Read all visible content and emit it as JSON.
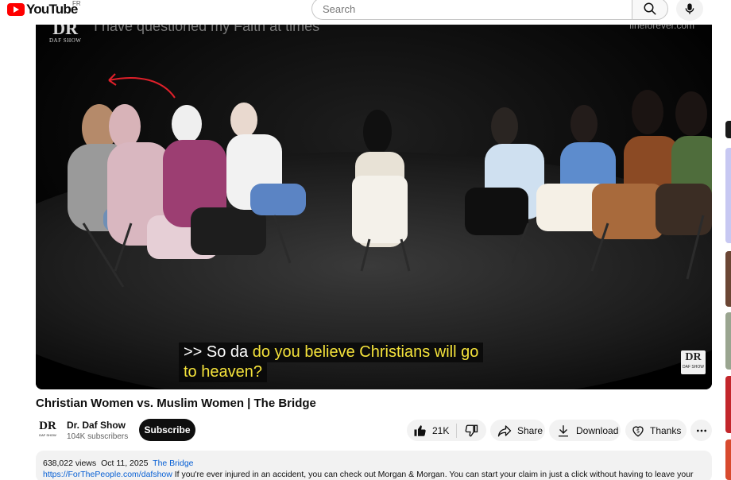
{
  "header": {
    "logo_text": "YouTube",
    "country_code": "FR",
    "search_placeholder": "Search"
  },
  "player": {
    "overlay_text": "I have questioned my Faith at times",
    "site_watermark": "fineforever.com",
    "brand_mark": "DR",
    "brand_sub": "DAF SHOW",
    "caption_line1_prefix": ">> So da",
    "caption_line1_highlight": "do you believe Christians will go",
    "caption_line2_highlight": "to heaven?"
  },
  "video": {
    "title": "Christian Women vs. Muslim Women | The Bridge"
  },
  "channel": {
    "name": "Dr. Daf Show",
    "subscribers": "104K subscribers",
    "avatar_mark": "DR",
    "avatar_sub": "DAF SHOW",
    "subscribe_label": "Subscribe"
  },
  "actions": {
    "like_count": "21K",
    "share_label": "Share",
    "download_label": "Download",
    "thanks_label": "Thanks"
  },
  "description": {
    "views": "638,022 views",
    "date": "Oct 11, 2025",
    "tag": "The Bridge",
    "link": "https://ForThePeople.com/dafshow",
    "text": "If you're ever injured in an accident, you can check out Morgan & Morgan. You can start your claim in just a click without having to leave your"
  },
  "colors": {
    "brand_red": "#ff0000",
    "caption_highlight": "#f5e33b",
    "link_blue": "#065fd4",
    "annotation_arrow": "#e0202a"
  },
  "icons": {
    "search": "search-icon",
    "mic": "mic-icon",
    "like": "thumbs-up-icon",
    "dislike": "thumbs-down-icon",
    "share": "share-arrow-icon",
    "download": "download-icon",
    "thanks": "thanks-heart-dollar-icon",
    "more": "more-horizontal-icon"
  }
}
